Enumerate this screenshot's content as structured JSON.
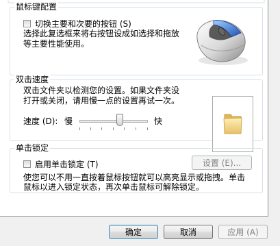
{
  "button_config": {
    "title": "鼠标键配置",
    "swap_checkbox_label": "切换主要和次要的按钮 (S)",
    "swap_checked": false,
    "description_line1": "选择此复选框来将右按钮设成如选择和拖放",
    "description_line2": "等主要性能使用。"
  },
  "double_click": {
    "title": "双击速度",
    "description_line1": "双击文件夹以检测您的设置。如果文件夹没",
    "description_line2": "打开或关闭，请用慢一点的设置再试一次。",
    "speed_label": "速度 (D):",
    "slow_label": "慢",
    "fast_label": "快",
    "speed_level": 0.55
  },
  "click_lock": {
    "title": "单击锁定",
    "enable_checkbox_label": "启用单击锁定 (T)",
    "enable_checked": false,
    "settings_button": "设置 (E)...",
    "description_line1": "使您可以不用一直按着鼠标按钮就可以高亮显示或拖拽。单击",
    "description_line2": "鼠标以进入锁定状态，再次单击鼠标可解除锁定。"
  },
  "dialog_buttons": {
    "ok": "确定",
    "cancel": "取消",
    "apply": "应用 (A)"
  },
  "icons": {
    "mouse": "mouse-illustration",
    "folder": "folder-icon"
  }
}
